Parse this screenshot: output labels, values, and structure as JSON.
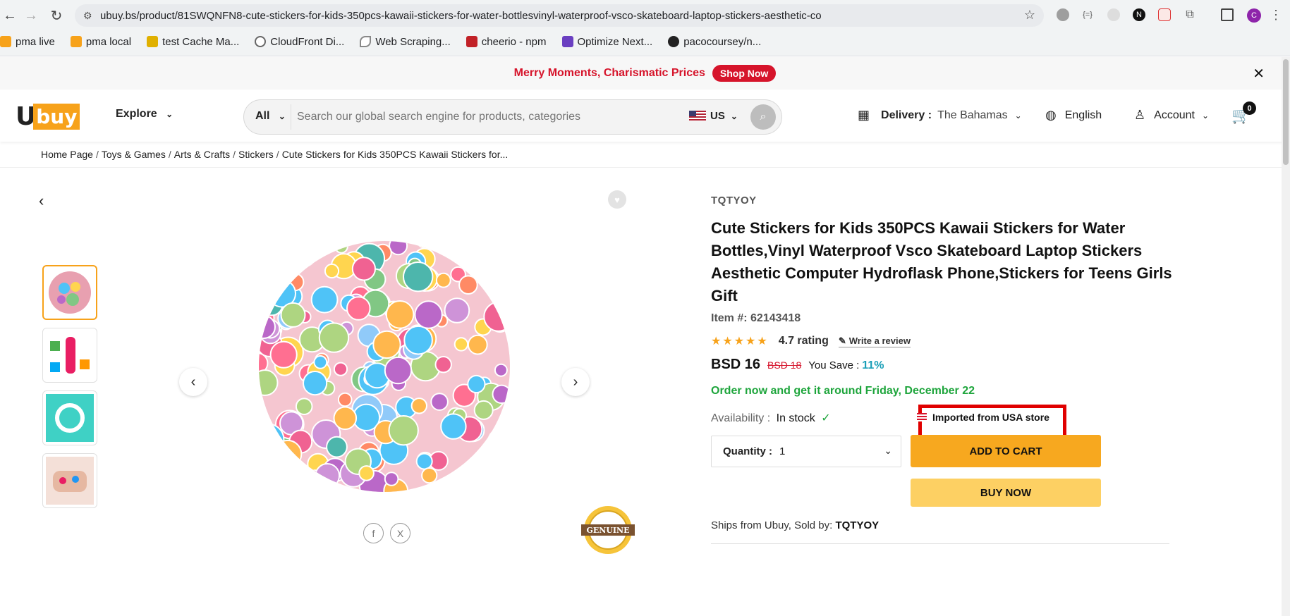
{
  "browser": {
    "url": "ubuy.bs/product/81SWQNFN8-cute-stickers-for-kids-350pcs-kawaii-stickers-for-water-bottlesvinyl-waterproof-vsco-skateboard-laptop-stickers-aesthetic-co",
    "profile_initial": "C",
    "ext_n": "N",
    "bookmarks": [
      {
        "label": "pma live",
        "color": "#f7a21a"
      },
      {
        "label": "pma local",
        "color": "#f7a21a"
      },
      {
        "label": "test Cache Ma...",
        "color": "#e0b000"
      },
      {
        "label": "CloudFront Di...",
        "color": "#666666"
      },
      {
        "label": "Web Scraping...",
        "color": "#888888"
      },
      {
        "label": "cheerio - npm",
        "color": "#c12127"
      },
      {
        "label": "Optimize Next...",
        "color": "#6a3fc1"
      },
      {
        "label": "pacocoursey/n...",
        "color": "#222222"
      }
    ]
  },
  "promo": {
    "text": "Merry Moments, Charismatic Prices",
    "button": "Shop Now",
    "accent": "#d6142b"
  },
  "header": {
    "logo_u": "U",
    "logo_buy": "buy",
    "explore": "Explore",
    "search_category": "All",
    "search_placeholder": "Search our global search engine for products, categories",
    "country": "US",
    "delivery_label": "Delivery :",
    "delivery_value": "The Bahamas",
    "language": "English",
    "account": "Account",
    "cart_count": "0"
  },
  "breadcrumb": [
    "Home Page",
    "Toys & Games",
    "Arts & Crafts",
    "Stickers",
    "Cute Stickers for Kids 350PCS Kawaii Stickers for..."
  ],
  "gallery": {
    "genuine_label": "GENUINE",
    "share": [
      "f",
      "X"
    ]
  },
  "product": {
    "brand": "TQTYOY",
    "title": "Cute Stickers for Kids 350PCS Kawaii Stickers for Water Bottles,Vinyl Waterproof Vsco Skateboard Laptop Stickers Aesthetic Computer Hydroflask Phone,Stickers for Teens Girls Gift",
    "item_no": "Item #: 62143418",
    "stars": "★★★★★",
    "rating": "4.7 rating",
    "write_review": "Write a review",
    "price": "BSD 16",
    "old_price": "BSD 18",
    "you_save_label": "You Save :",
    "you_save_pct": "11%",
    "delivery_msg": "Order now and get it around Friday, December 22",
    "availability_label": "Availability :",
    "availability_value": "In stock",
    "imported": "Imported from USA store",
    "quantity_label": "Quantity :",
    "quantity_value": "1",
    "add_to_cart": "ADD TO CART",
    "buy_now": "BUY NOW",
    "ships_from": "Ships from Ubuy, Sold by:",
    "seller": "TQTYOY"
  },
  "colors": {
    "brand_orange": "#f7a21a",
    "sale_red": "#d6142b",
    "green": "#1ea53c",
    "highlight_box": "#e00000"
  }
}
